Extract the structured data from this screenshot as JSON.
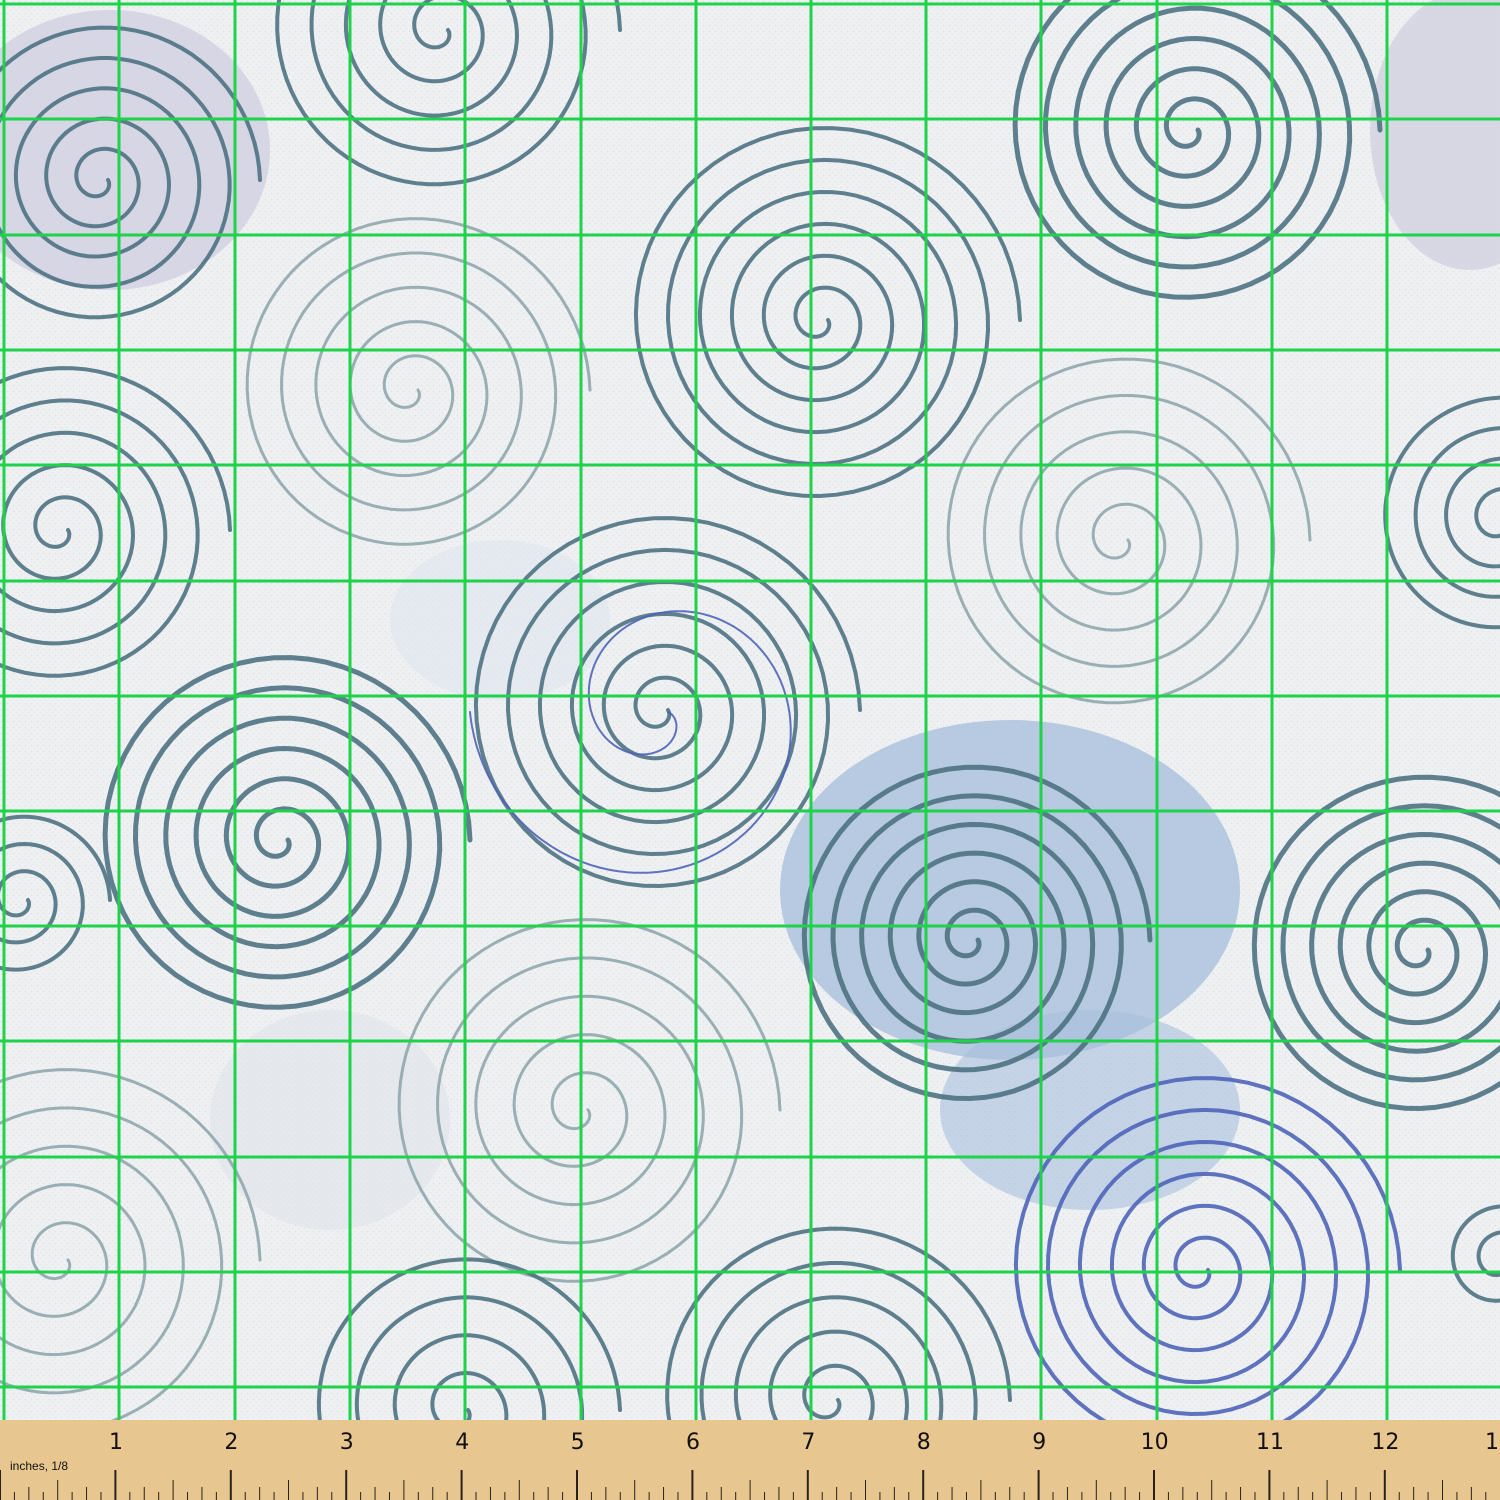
{
  "ruler": {
    "caption": "inches, 1/8",
    "numbers": [
      "1",
      "2",
      "3",
      "4",
      "5",
      "6",
      "7",
      "8",
      "9",
      "10",
      "11",
      "12",
      "1"
    ]
  },
  "colors": {
    "fabric_background": "#eef0f2",
    "swirl_teal": "#4e7282",
    "swirl_light": "#8fa7ad",
    "swirl_blue": "#4f64b8",
    "wash_lavender": "#cfcde0",
    "wash_blue": "#a9c0dc",
    "grid_green": "#1ed34a",
    "ruler_wood": "#e7c690"
  }
}
